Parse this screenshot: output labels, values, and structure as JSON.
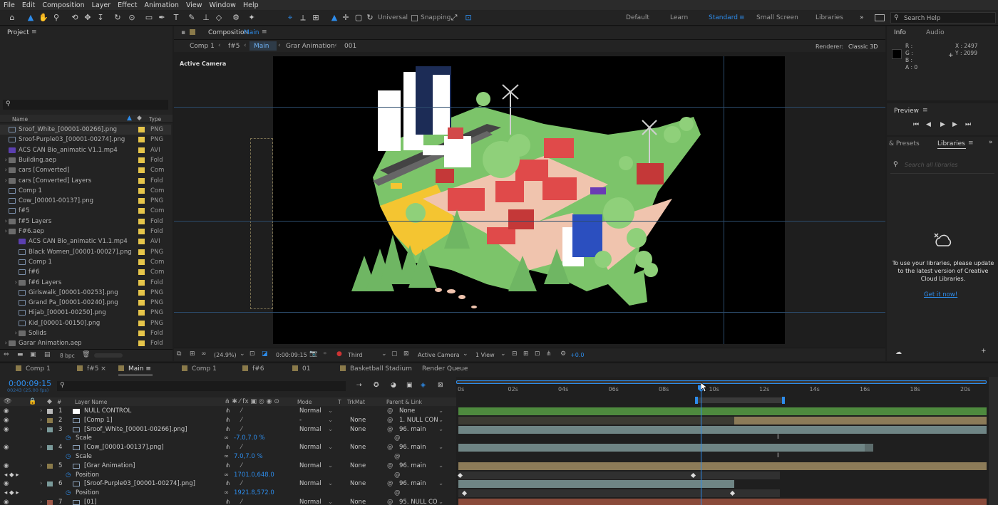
{
  "menu": [
    "File",
    "Edit",
    "Composition",
    "Layer",
    "Effect",
    "Animation",
    "View",
    "Window",
    "Help"
  ],
  "toolbar": {
    "universal_label": "Universal",
    "snapping_label": "Snapping",
    "workspaces": [
      "Default",
      "Learn",
      "Standard",
      "Small Screen",
      "Libraries"
    ],
    "active_workspace": "Standard",
    "search_placeholder": "Search Help"
  },
  "project": {
    "title": "Project",
    "col_name": "Name",
    "col_type": "Type",
    "bpc": "8 bpc",
    "items": [
      {
        "name": "Sroof_White_[00001-00266].png",
        "type": "PNG",
        "kind": "img",
        "indent": 0,
        "label": "#e6c54a"
      },
      {
        "name": "Sroof-Purple03_[00001-00274].png",
        "type": "PNG",
        "kind": "img",
        "indent": 0,
        "label": "#e6c54a"
      },
      {
        "name": "ACS CAN Bio_animatic V1.1.mp4",
        "type": "AVI",
        "kind": "avi",
        "indent": 0,
        "label": "#e6c54a"
      },
      {
        "name": "Building.aep",
        "type": "Fold",
        "kind": "folder",
        "indent": 0,
        "label": "#e6c54a"
      },
      {
        "name": "cars [Converted]",
        "type": "Com",
        "kind": "folder",
        "indent": 0,
        "label": "#e6c54a"
      },
      {
        "name": "cars [Converted] Layers",
        "type": "Fold",
        "kind": "folder",
        "indent": 0,
        "label": "#e6c54a"
      },
      {
        "name": "Comp 1",
        "type": "Com",
        "kind": "img",
        "indent": 0,
        "label": "#e6c54a"
      },
      {
        "name": "Cow_[00001-00137].png",
        "type": "PNG",
        "kind": "img",
        "indent": 0,
        "label": "#e6c54a"
      },
      {
        "name": "f#5",
        "type": "Com",
        "kind": "img",
        "indent": 0,
        "label": "#e6c54a"
      },
      {
        "name": "f#5 Layers",
        "type": "Fold",
        "kind": "folder",
        "indent": 0,
        "label": "#e6c54a"
      },
      {
        "name": "F#6.aep",
        "type": "Fold",
        "kind": "folder",
        "indent": 0,
        "label": "#e6c54a"
      },
      {
        "name": "ACS CAN Bio_animatic V1.1.mp4",
        "type": "AVI",
        "kind": "avi",
        "indent": 1,
        "label": "#e6c54a"
      },
      {
        "name": "Black Women_[00001-00027].png",
        "type": "PNG",
        "kind": "img",
        "indent": 1,
        "label": "#e6c54a"
      },
      {
        "name": "Comp 1",
        "type": "Com",
        "kind": "img",
        "indent": 1,
        "label": "#e6c54a"
      },
      {
        "name": "f#6",
        "type": "Com",
        "kind": "img",
        "indent": 1,
        "label": "#e6c54a"
      },
      {
        "name": "f#6 Layers",
        "type": "Fold",
        "kind": "folder",
        "indent": 1,
        "label": "#e6c54a"
      },
      {
        "name": "Girlswalk_[00001-00253].png",
        "type": "PNG",
        "kind": "img",
        "indent": 1,
        "label": "#e6c54a"
      },
      {
        "name": "Grand Pa_[00001-00240].png",
        "type": "PNG",
        "kind": "img",
        "indent": 1,
        "label": "#e6c54a"
      },
      {
        "name": "Hijab_[00001-00250].png",
        "type": "PNG",
        "kind": "img",
        "indent": 1,
        "label": "#e6c54a"
      },
      {
        "name": "Kid_[00001-00150].png",
        "type": "PNG",
        "kind": "img",
        "indent": 1,
        "label": "#e6c54a"
      },
      {
        "name": "Solids",
        "type": "Fold",
        "kind": "folder",
        "indent": 1,
        "label": "#e6c54a"
      },
      {
        "name": "Garar Animation.aep",
        "type": "Fold",
        "kind": "folder",
        "indent": 0,
        "label": "#e6c54a"
      }
    ]
  },
  "composition": {
    "panel_title": "Composition",
    "comp_name": "Main",
    "breadcrumbs": [
      "Comp 1",
      "f#5",
      "Main",
      "Grar Animation",
      "001"
    ],
    "active_crumb": "Main",
    "renderer_label": "Renderer:",
    "renderer_value": "Classic 3D",
    "active_camera": "Active Camera",
    "zoom": "(24.9%)",
    "timecode": "0:00:09:15",
    "resolution": "Third",
    "camera_select": "Active Camera",
    "view_select": "1 View",
    "exposure": "+0.0"
  },
  "info": {
    "tab_info": "Info",
    "tab_audio": "Audio",
    "r": "R :",
    "g": "G :",
    "b": "B :",
    "a": "A : 0",
    "x": "X : 2497",
    "y": "Y : 2099"
  },
  "preview": {
    "title": "Preview"
  },
  "libraries": {
    "tab_presets": "& Presets",
    "tab_libraries": "Libraries",
    "search_placeholder": "Search all libraries",
    "message": "To use your libraries, please update to the latest version of Creative Cloud Libraries.",
    "link": "Get it now!"
  },
  "timeline_tabs": [
    {
      "label": "Comp 1",
      "color": "#8a7a4a",
      "active": false
    },
    {
      "label": "f#5",
      "color": "#8a7a4a",
      "active": false
    },
    {
      "label": "Main",
      "color": "#8a7a4a",
      "active": true
    },
    {
      "label": "Comp 1",
      "color": "#8a7a4a",
      "active": false
    },
    {
      "label": "f#6",
      "color": "#8a7a4a",
      "active": false
    },
    {
      "label": "01",
      "color": "#8a7a4a",
      "active": false
    },
    {
      "label": "Basketball Stadium",
      "color": "#8a7a4a",
      "active": false
    },
    {
      "label": "Render Queue",
      "color": "",
      "active": false
    }
  ],
  "timeline": {
    "timecode": "0:00:09:15",
    "frame_info": "00243 (25.00 fps)",
    "col_layer": "Layer Name",
    "col_mode": "Mode",
    "col_t": "T",
    "col_trkmat": "TrkMat",
    "col_parent": "Parent & Link",
    "ruler": [
      "0s",
      "02s",
      "04s",
      "06s",
      "08s",
      "10s",
      "12s",
      "14s",
      "16s",
      "18s",
      "20s"
    ],
    "layers": [
      {
        "num": "1",
        "name": "NULL CONTROL",
        "mode": "Normal",
        "trkmat": "",
        "parent": "None",
        "color": "#b9b9b9",
        "sub": false
      },
      {
        "num": "2",
        "name": "[Comp 1]",
        "mode": "-",
        "trkmat": "None",
        "parent": "1. NULL CON",
        "color": "#8a7a4a",
        "sub": false
      },
      {
        "num": "3",
        "name": "[Sroof_White_[00001-00266].png]",
        "mode": "Normal",
        "trkmat": "None",
        "parent": "96. main",
        "color": "#7a9a9a",
        "sub": false
      },
      {
        "num": "",
        "name": "Scale",
        "mode": "",
        "trkmat": "",
        "parent": "",
        "value": "-7.0,7.0 %",
        "sub": true
      },
      {
        "num": "4",
        "name": "[Cow_[00001-00137].png]",
        "mode": "Normal",
        "trkmat": "None",
        "parent": "96. main",
        "color": "#7a9a9a",
        "sub": false
      },
      {
        "num": "",
        "name": "Scale",
        "mode": "",
        "trkmat": "",
        "parent": "",
        "value": "7.0,7.0 %",
        "sub": true
      },
      {
        "num": "5",
        "name": "[Grar Animation]",
        "mode": "Normal",
        "trkmat": "None",
        "parent": "96. main",
        "color": "#8a7a4a",
        "sub": false
      },
      {
        "num": "",
        "name": "Position",
        "mode": "",
        "trkmat": "",
        "parent": "",
        "value": "1701.0,648.0",
        "sub": true
      },
      {
        "num": "6",
        "name": "[Sroof-Purple03_[00001-00274].png]",
        "mode": "Normal",
        "trkmat": "None",
        "parent": "96. main",
        "color": "#7a9a9a",
        "sub": false
      },
      {
        "num": "",
        "name": "Position",
        "mode": "",
        "trkmat": "",
        "parent": "",
        "value": "1921.8,572.0",
        "sub": true
      },
      {
        "num": "7",
        "name": "[01]",
        "mode": "Normal",
        "trkmat": "None",
        "parent": "95. NULL CO",
        "color": "#a05a4a",
        "sub": false
      }
    ]
  },
  "colors": {
    "accent": "#2d8ceb",
    "bar_green": "#4e8a3e",
    "bar_teal": "#6f8585",
    "bar_tan": "#8c7b58",
    "bar_red": "#8a4a3a"
  }
}
